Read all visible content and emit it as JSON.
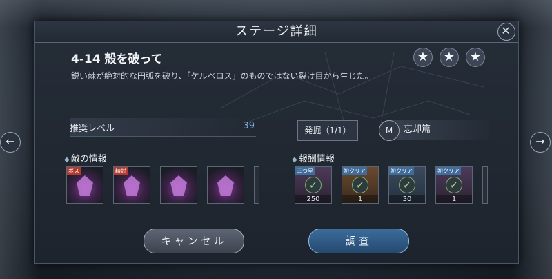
{
  "dialog": {
    "title": "ステージ詳細",
    "close_icon": "✕",
    "stage_name": "4-14 殻を破って",
    "description": "鋭い棘が絶対的な円弧を破り、「ケルベロス」のものではない裂け目から生じた。",
    "stars": [
      "★",
      "★",
      "★"
    ],
    "recommended_level_label": "推奨レベル",
    "recommended_level_value": "39",
    "dig_label": "発掘（1/1）",
    "chapter_icon": "M",
    "chapter_label": "忘却篇",
    "enemy_section_title": "敵の情報",
    "reward_section_title": "報酬情報",
    "bullet": "◆",
    "enemies": [
      {
        "tag": "ボス"
      },
      {
        "tag": "精鋭"
      },
      {
        "tag": ""
      },
      {
        "tag": ""
      }
    ],
    "rewards": [
      {
        "tag": "三つ星",
        "count": "250",
        "check": "✓"
      },
      {
        "tag": "初クリア",
        "count": "1",
        "check": "✓"
      },
      {
        "tag": "初クリア",
        "count": "30",
        "check": "✓"
      },
      {
        "tag": "初クリア",
        "count": "1",
        "check": "✓"
      }
    ],
    "cancel_label": "キャンセル",
    "investigate_label": "調査"
  },
  "nav": {
    "left_arrow": "←",
    "right_arrow": "→"
  },
  "colors": {
    "accent_blue": "#7fb6e8",
    "check_green": "#9fe07a",
    "boss_tag": "#b33a2e"
  }
}
